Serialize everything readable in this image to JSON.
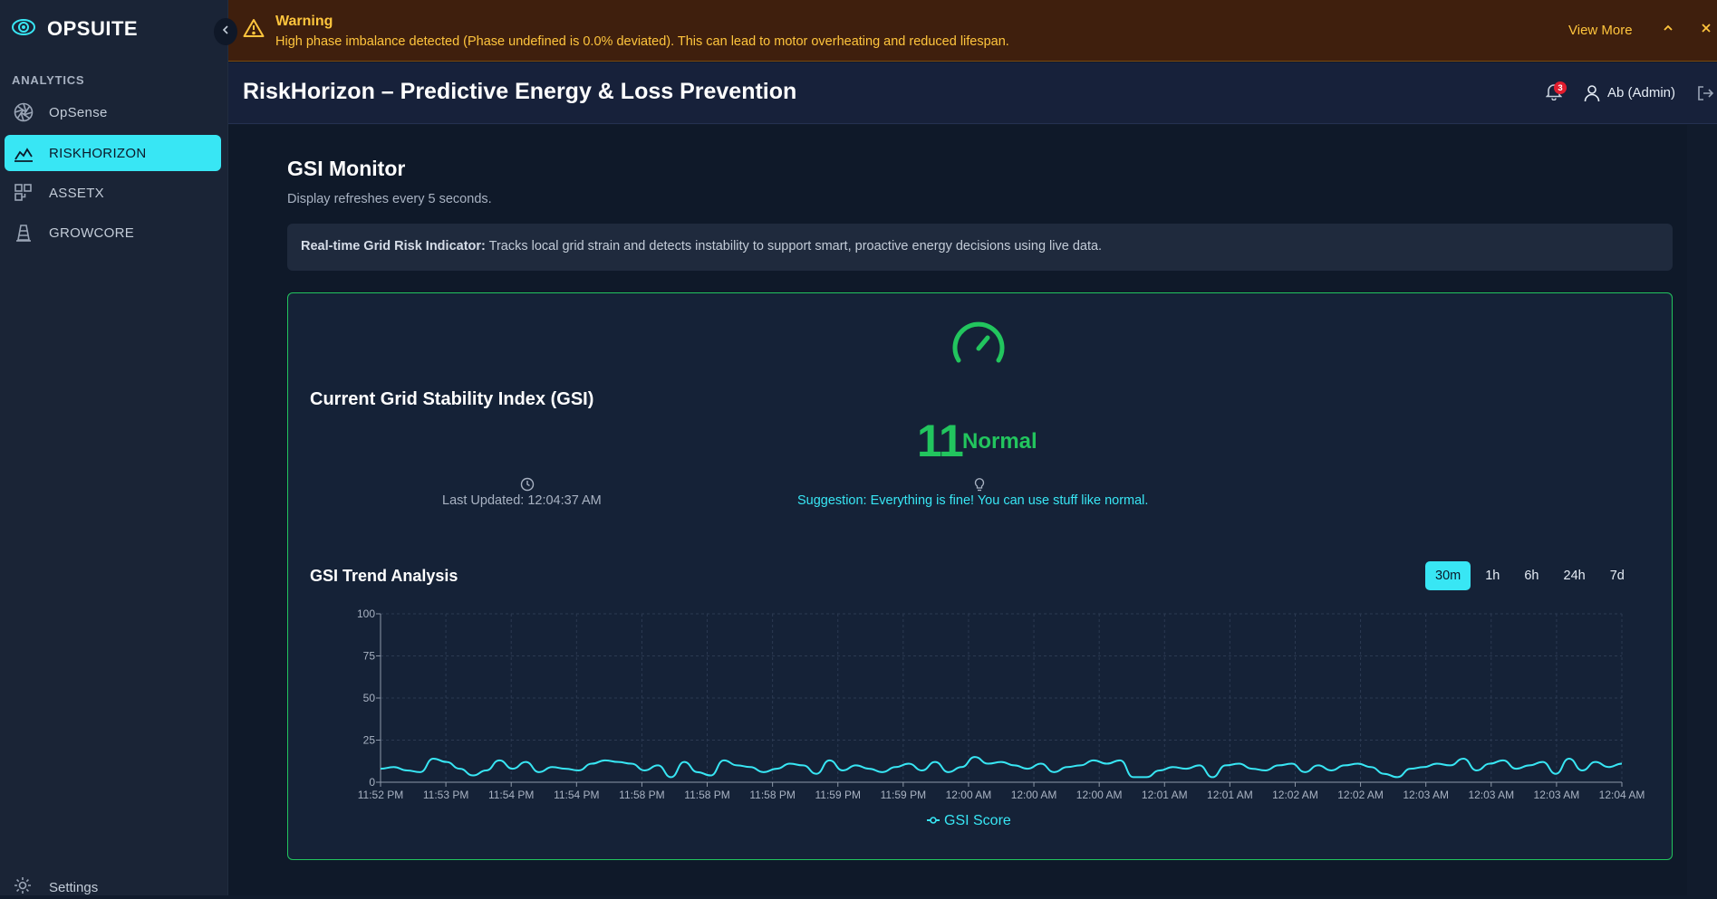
{
  "sidebar": {
    "brand": "OPSUITE",
    "section": "ANALYTICS",
    "items": [
      {
        "label": "OpSense",
        "icon": "aperture-icon"
      },
      {
        "label": "RISKHORIZON",
        "icon": "area-chart-icon"
      },
      {
        "label": "ASSETX",
        "icon": "blocks-icon"
      },
      {
        "label": "GROWCORE",
        "icon": "cone-icon"
      }
    ],
    "settings": "Settings"
  },
  "warning": {
    "title": "Warning",
    "message": "High phase imbalance detected (Phase undefined is 0.0% deviated). This can lead to motor overheating and reduced lifespan.",
    "view_more": "View More"
  },
  "header": {
    "title": "RiskHorizon – Predictive Energy & Loss Prevention",
    "notification_count": "3",
    "user": "Ab (Admin)"
  },
  "gsi": {
    "title": "GSI Monitor",
    "subtitle": "Display refreshes every 5 seconds.",
    "info_label": "Real-time Grid Risk Indicator:",
    "info_text": " Tracks local grid strain and detects instability to support smart, proactive energy decisions using live data.",
    "current_title": "Current Grid Stability Index (GSI)",
    "value": "11",
    "status": "Normal",
    "last_updated": "Last Updated: 12:04:37 AM",
    "suggestion": "Suggestion: Everything is fine! You can use stuff like normal.",
    "trend_title": "GSI Trend Analysis",
    "ranges": [
      "30m",
      "1h",
      "6h",
      "24h",
      "7d"
    ],
    "active_range": "30m",
    "status_color": "#22c55e",
    "accent_color": "#38e6f4"
  },
  "chart_data": {
    "type": "line",
    "ylim": [
      0,
      100
    ],
    "yticks": [
      0,
      25,
      50,
      75,
      100
    ],
    "x_tick_labels": [
      "11:52 PM",
      "11:53 PM",
      "11:54 PM",
      "11:54 PM",
      "11:58 PM",
      "11:58 PM",
      "11:58 PM",
      "11:59 PM",
      "11:59 PM",
      "12:00 AM",
      "12:00 AM",
      "12:00 AM",
      "12:01 AM",
      "12:01 AM",
      "12:02 AM",
      "12:02 AM",
      "12:03 AM",
      "12:03 AM",
      "12:03 AM",
      "12:04 AM"
    ],
    "grid": true,
    "series": [
      {
        "name": "GSI Score",
        "color": "#38e6f4",
        "values": [
          8,
          9,
          7,
          6,
          14,
          12,
          8,
          4,
          7,
          13,
          8,
          12,
          6,
          9,
          8,
          7,
          11,
          13,
          12,
          11,
          7,
          10,
          3,
          12,
          6,
          4,
          13,
          10,
          9,
          6,
          8,
          11,
          10,
          5,
          13,
          7,
          10,
          8,
          6,
          9,
          11,
          7,
          12,
          6,
          9,
          15,
          11,
          12,
          10,
          8,
          11,
          6,
          9,
          10,
          13,
          11,
          13,
          3,
          3,
          7,
          9,
          8,
          10,
          3,
          10,
          11,
          8,
          7,
          10,
          11,
          6,
          10,
          7,
          10,
          11,
          9,
          5,
          3,
          8,
          9,
          11,
          10,
          14,
          7,
          11,
          13,
          8,
          10,
          12,
          5,
          14,
          7,
          12,
          9,
          11
        ]
      }
    ],
    "legend": "bottom-center"
  }
}
